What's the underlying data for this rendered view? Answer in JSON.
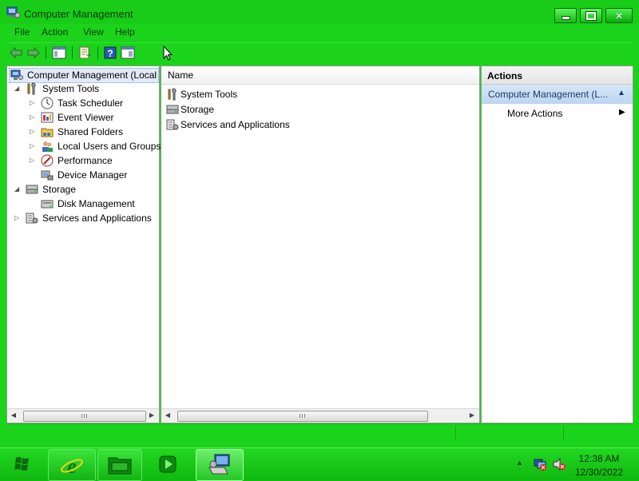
{
  "window": {
    "title": "Computer Management",
    "controls": {
      "minimize": "minimize",
      "maximize": "maximize",
      "close": "close"
    }
  },
  "menubar": {
    "items": [
      "File",
      "Action",
      "View",
      "Help"
    ]
  },
  "tree": {
    "root": "Computer Management (Local",
    "items": [
      {
        "label": "System Tools",
        "level": 1,
        "expanded": true
      },
      {
        "label": "Task Scheduler",
        "level": 2
      },
      {
        "label": "Event Viewer",
        "level": 2
      },
      {
        "label": "Shared Folders",
        "level": 2
      },
      {
        "label": "Local Users and Groups",
        "level": 2
      },
      {
        "label": "Performance",
        "level": 2
      },
      {
        "label": "Device Manager",
        "level": 2
      },
      {
        "label": "Storage",
        "level": 1,
        "expanded": true
      },
      {
        "label": "Disk Management",
        "level": 2
      },
      {
        "label": "Services and Applications",
        "level": 1
      }
    ]
  },
  "list": {
    "column_header": "Name",
    "items": [
      "System Tools",
      "Storage",
      "Services and Applications"
    ]
  },
  "actions": {
    "header": "Actions",
    "section": "Computer Management (L...",
    "items": [
      "More Actions"
    ]
  },
  "scroll_thumb": "III",
  "taskbar": {
    "time": "12:38 AM",
    "date": "12/30/2022"
  },
  "colors": {
    "theme_green": "#1bd31b",
    "selection_blue": "#bdd5f0"
  }
}
